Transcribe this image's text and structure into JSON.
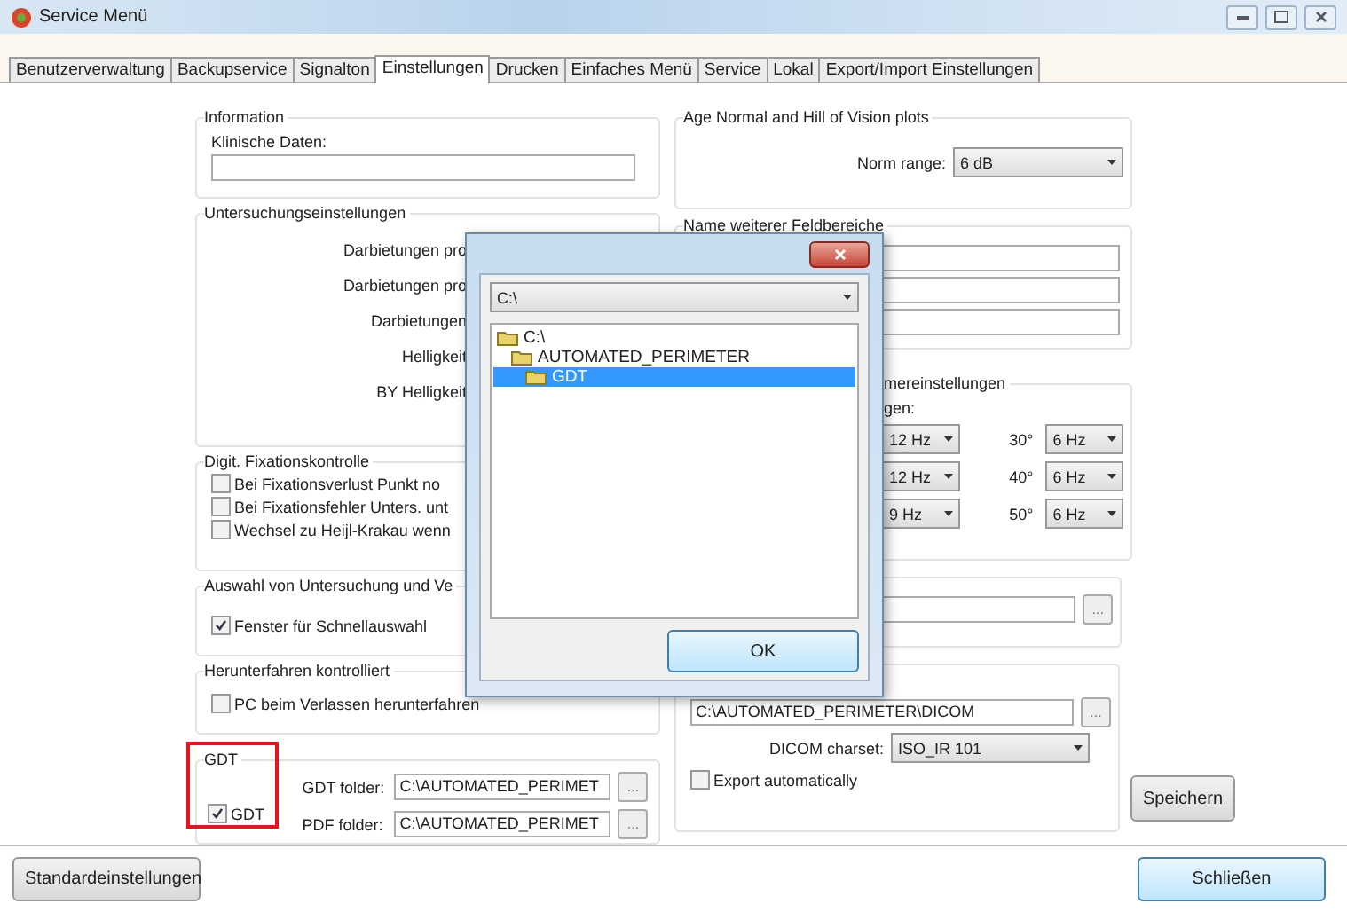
{
  "window": {
    "title": "Service Menü"
  },
  "tabs": [
    {
      "label": "Benutzerverwaltung",
      "selected": false
    },
    {
      "label": "Backupservice",
      "selected": false
    },
    {
      "label": "Signalton",
      "selected": false
    },
    {
      "label": "Einstellungen",
      "selected": true
    },
    {
      "label": "Drucken",
      "selected": false
    },
    {
      "label": "Einfaches Menü",
      "selected": false
    },
    {
      "label": "Service",
      "selected": false
    },
    {
      "label": "Lokal",
      "selected": false
    },
    {
      "label": "Export/Import Einstellungen",
      "selected": false
    }
  ],
  "information": {
    "title": "Information",
    "label": "Klinische Daten:"
  },
  "examination_settings": {
    "title": "Untersuchungseinstellungen",
    "labels": [
      "Darbietungen pro",
      "Darbietungen pro",
      "Darbietungen",
      "Helligkeit",
      "BY Helligkeit"
    ]
  },
  "fixation": {
    "title": "Digit. Fixationskontrolle",
    "options": [
      {
        "label": "Bei Fixationsverlust Punkt no",
        "checked": false
      },
      {
        "label": "Bei Fixationsfehler Unters. unt",
        "checked": false
      },
      {
        "label": "Wechsel zu Heijl-Krakau wenn",
        "checked": false
      }
    ]
  },
  "selection": {
    "title": "Auswahl von Untersuchung und Ve",
    "options": [
      {
        "label": "Fenster für Schnellauswahl",
        "checked": true
      }
    ]
  },
  "shutdown": {
    "title": "Herunterfahren kontrolliert",
    "options": [
      {
        "label": "PC beim Verlassen herunterfahren",
        "checked": false
      }
    ]
  },
  "gdt": {
    "title": "GDT",
    "highlighted": true,
    "option": {
      "label": "GDT",
      "checked": true
    },
    "folders": [
      {
        "label": "GDT folder:",
        "value": "C:\\AUTOMATED_PERIMET",
        "button": "..."
      },
      {
        "label": "PDF folder:",
        "value": "C:\\AUTOMATED_PERIMET",
        "button": "..."
      }
    ]
  },
  "age_normal": {
    "title": "Age Normal and Hill of Vision plots",
    "label": "Norm range:",
    "value": "6 dB"
  },
  "field_names": {
    "title": "Name weiterer Feldbereiche"
  },
  "stimulus_settings": {
    "title": "mereinstellungen",
    "label": "gen:",
    "rows": [
      {
        "left_value": "12 Hz",
        "angle": "30°",
        "right_value": "6 Hz"
      },
      {
        "left_value": "12 Hz",
        "angle": "40°",
        "right_value": "6 Hz"
      },
      {
        "left_value": "9 Hz",
        "angle": "50°",
        "right_value": "6 Hz"
      }
    ]
  },
  "path_group": {
    "button": "..."
  },
  "dicom": {
    "path": "C:\\AUTOMATED_PERIMETER\\DICOM",
    "button": "...",
    "charset_label": "DICOM charset:",
    "charset": "ISO_IR 101",
    "export": {
      "label": "Export automatically",
      "checked": false
    }
  },
  "save_button": "Speichern",
  "footer": {
    "defaults_button": "Standardeinstellungen",
    "close_button": "Schließen"
  },
  "dialog": {
    "path": "C:\\",
    "tree": [
      {
        "label": "C:\\",
        "selected": false,
        "children": [
          {
            "label": "AUTOMATED_PERIMETER",
            "selected": false,
            "children": [
              {
                "label": "GDT",
                "selected": true
              }
            ]
          }
        ]
      }
    ],
    "ok": "OK"
  }
}
